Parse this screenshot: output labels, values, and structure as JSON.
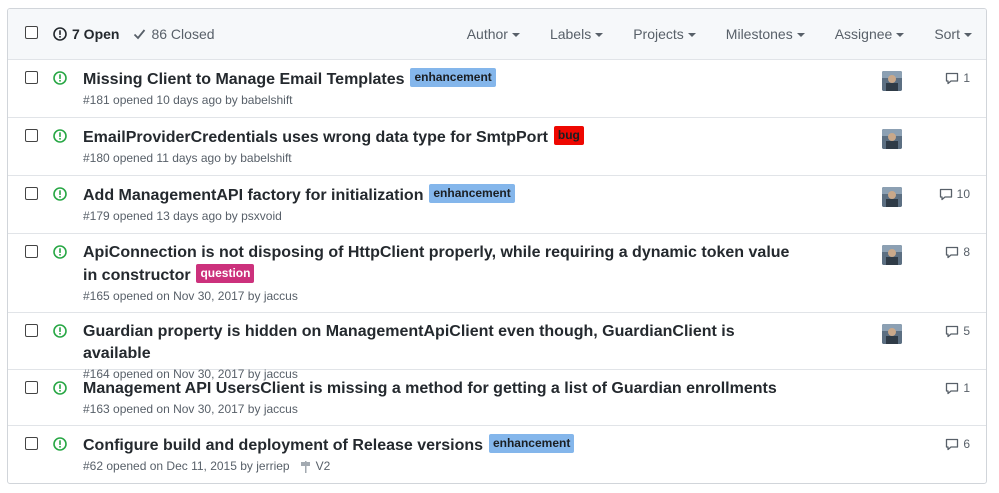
{
  "header": {
    "open_label": "7 Open",
    "closed_label": "86 Closed",
    "filters": [
      "Author",
      "Labels",
      "Projects",
      "Milestones",
      "Assignee",
      "Sort"
    ]
  },
  "colors": {
    "open_icon": "#28a745",
    "enhancement": "#84b6eb",
    "bug": "#ee0701",
    "question": "#cc317c"
  },
  "issues": [
    {
      "title": "Missing Client to Manage Email Templates",
      "label": "enhancement",
      "meta": "#181 opened 10 days ago by babelshift",
      "comments": "1",
      "avatar": true,
      "milestone": ""
    },
    {
      "title": "EmailProviderCredentials uses wrong data type for SmtpPort",
      "label": "bug",
      "meta": "#180 opened 11 days ago by babelshift",
      "comments": "",
      "avatar": true,
      "milestone": ""
    },
    {
      "title": "Add ManagementAPI factory for initialization",
      "label": "enhancement",
      "meta": "#179 opened 13 days ago by psxvoid",
      "comments": "10",
      "avatar": true,
      "milestone": ""
    },
    {
      "title": "ApiConnection is not disposing of HttpClient properly, while requiring a dynamic token value in constructor",
      "label": "question",
      "meta": "#165 opened on Nov 30, 2017 by jaccus",
      "comments": "8",
      "avatar": true,
      "milestone": ""
    },
    {
      "title": "Guardian property is hidden on ManagementApiClient even though, GuardianClient is available",
      "label": "",
      "meta": "#164 opened on Nov 30, 2017 by jaccus",
      "comments": "5",
      "avatar": true,
      "milestone": ""
    },
    {
      "title": "Management API UsersClient is missing a method for getting a list of Guardian enrollments",
      "label": "",
      "meta": "#163 opened on Nov 30, 2017 by jaccus",
      "comments": "1",
      "avatar": false,
      "milestone": ""
    },
    {
      "title": "Configure build and deployment of Release versions",
      "label": "enhancement",
      "meta": "#62 opened on Dec 11, 2015 by jerriep",
      "comments": "6",
      "avatar": false,
      "milestone": "V2"
    }
  ]
}
